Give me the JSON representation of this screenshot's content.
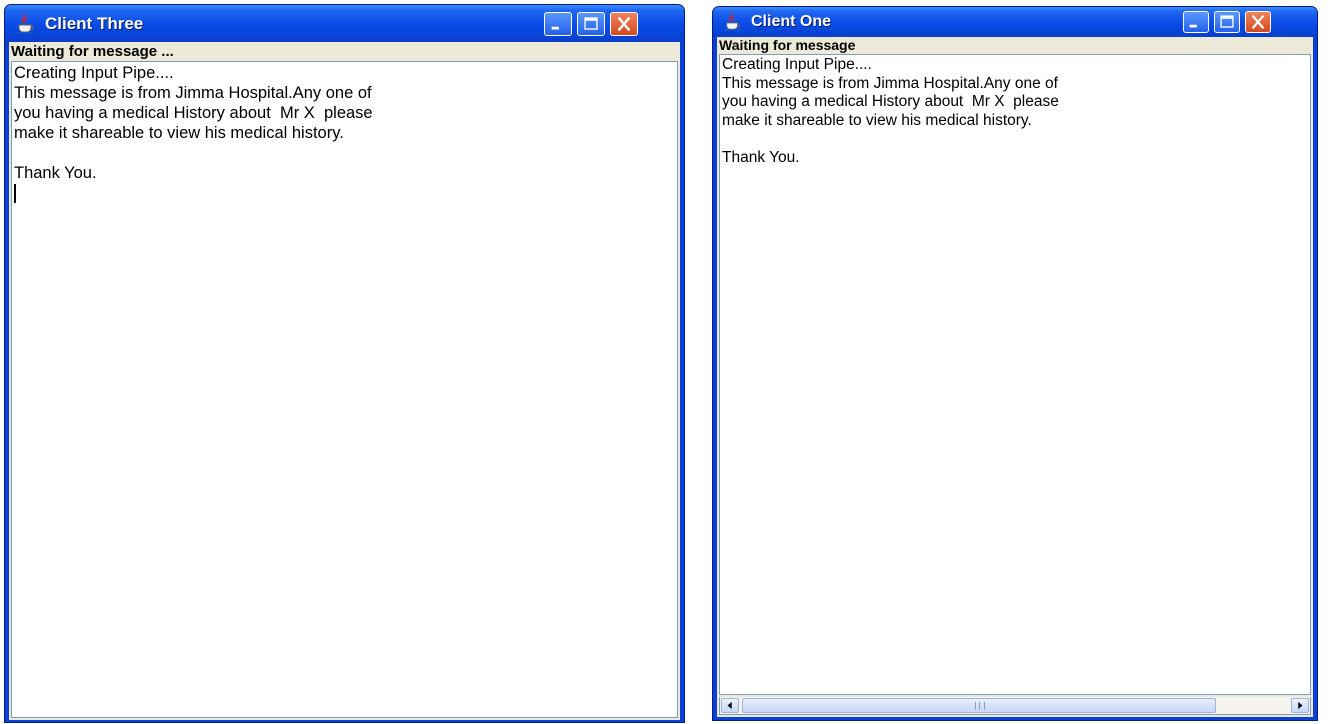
{
  "windows": [
    {
      "title": "Client Three",
      "status": "Waiting for message ...",
      "lines": [
        "Creating Input Pipe....",
        "This message is from Jimma Hospital.Any one of",
        "you having a medical History about  Mr X  please",
        "make it shareable to view his medical history.",
        "",
        "Thank You."
      ]
    },
    {
      "title": "Client One",
      "status": "Waiting for message",
      "lines": [
        "Creating Input Pipe....",
        "This message is from Jimma Hospital.Any one of",
        "you having a medical History about  Mr X  please",
        "make it shareable to view his medical history.",
        "",
        "Thank You."
      ]
    }
  ],
  "icons": {
    "app": "java-coffee-cup-icon",
    "minimize": "minimize-icon",
    "maximize": "maximize-icon",
    "close": "close-icon",
    "scroll_left": "arrow-left-icon",
    "scroll_right": "arrow-right-icon"
  },
  "colors": {
    "titlebar": "#0a4be6",
    "close_button": "#d4491d",
    "panel": "#ece9d8"
  }
}
